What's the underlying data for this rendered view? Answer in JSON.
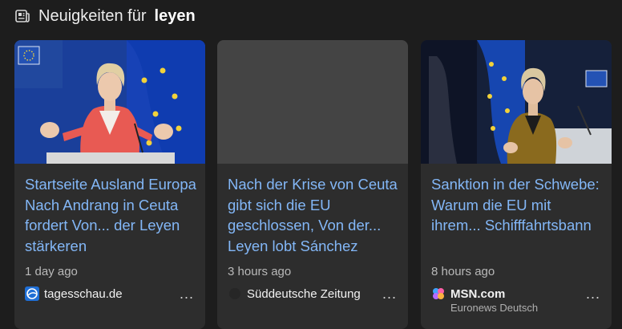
{
  "header": {
    "prefix": "Neuigkeiten für",
    "term": "leyen",
    "icon": "newspaper-icon"
  },
  "cards": [
    {
      "title": "Startseite Ausland Europa Nach Andrang in Ceuta fordert Von... der Leyen stärkeren",
      "age": "1 day ago",
      "source": "tagesschau.de",
      "source_icon": "tagesschau-logo-icon",
      "more": "..."
    },
    {
      "title": "Nach der Krise von Ceuta gibt sich die EU geschlossen, Von der... Leyen lobt Sánchez",
      "age": "3 hours ago",
      "source": "Süddeutsche Zeitung",
      "source_icon": "sueddeutsche-logo-icon",
      "more": "..."
    },
    {
      "title": "Sanktion in der Schwebe: Warum die EU mit ihrem... Schifffahrtsbann",
      "age": "8 hours ago",
      "source": "MSN.com",
      "source_sub": "Euronews Deutsch",
      "source_icon": "msn-logo-icon",
      "more": "..."
    }
  ],
  "colors": {
    "background": "#1d1d1d",
    "card": "#2d2d2d",
    "title_link": "#83b7f7",
    "placeholder": "#444444"
  }
}
